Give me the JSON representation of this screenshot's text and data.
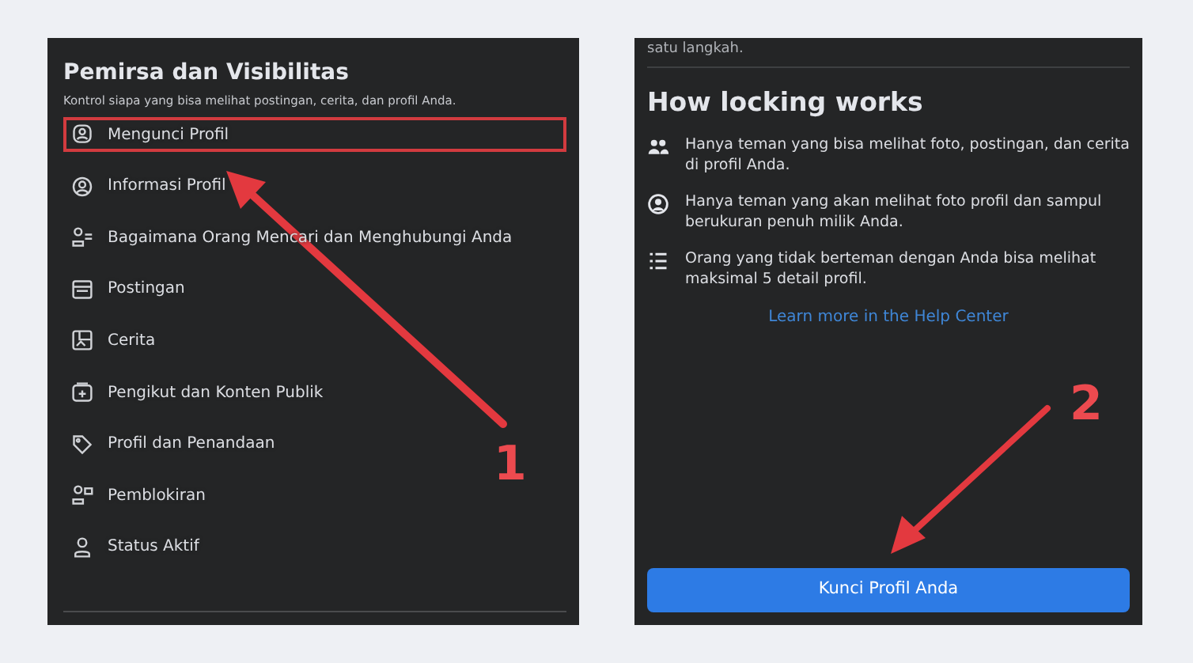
{
  "left_panel": {
    "title": "Pemirsa dan Visibilitas",
    "subtitle": "Kontrol siapa yang bisa melihat postingan, cerita, dan profil Anda.",
    "items": [
      {
        "label": "Mengunci Profil",
        "selected": true
      },
      {
        "label": "Informasi Profil",
        "selected": false
      },
      {
        "label": "Bagaimana Orang Mencari dan Menghubungi Anda",
        "selected": false
      },
      {
        "label": "Postingan",
        "selected": false
      },
      {
        "label": "Cerita",
        "selected": false
      },
      {
        "label": "Pengikut dan Konten Publik",
        "selected": false
      },
      {
        "label": "Profil dan Penandaan",
        "selected": false
      },
      {
        "label": "Pemblokiran",
        "selected": false
      },
      {
        "label": "Status Aktif",
        "selected": false
      }
    ]
  },
  "right_panel": {
    "top_text": "satu langkah.",
    "title": "How locking works",
    "points": [
      "Hanya teman yang bisa melihat foto, postingan, dan cerita di profil Anda.",
      "Hanya teman yang akan melihat foto profil dan sampul berukuran penuh milik Anda.",
      "Orang yang tidak berteman dengan Anda bisa melihat maksimal 5 detail profil."
    ],
    "link": "Learn more in the Help Center",
    "button": "Kunci Profil Anda"
  },
  "steps": [
    "1",
    "2"
  ]
}
